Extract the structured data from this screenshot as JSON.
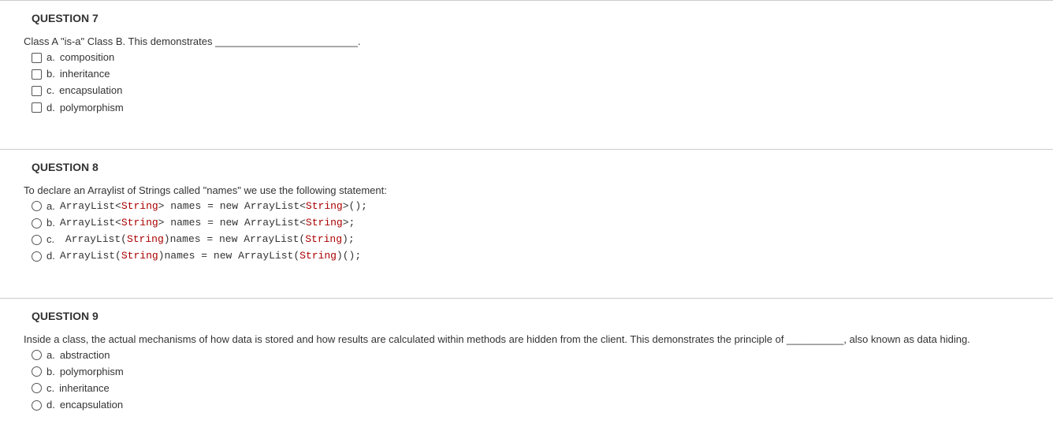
{
  "questions": [
    {
      "title": "QUESTION 7",
      "prompt": "Class A \"is-a\" Class B.  This demonstrates _________________________.",
      "input_type": "checkbox",
      "options": [
        {
          "letter": "a.",
          "text": "composition"
        },
        {
          "letter": "b.",
          "text": "inheritance"
        },
        {
          "letter": "c.",
          "text": "encapsulation"
        },
        {
          "letter": "d.",
          "text": "polymorphism"
        }
      ]
    },
    {
      "title": "QUESTION 8",
      "prompt": "To declare an Arraylist of Strings called \"names\" we  use the following statement:",
      "input_type": "radio",
      "code_options": [
        {
          "letter": "a.",
          "segments": [
            {
              "t": "ArrayList<"
            },
            {
              "t": "String",
              "kw": true
            },
            {
              "t": "> names = "
            },
            {
              "t": "new "
            },
            {
              "t": "ArrayList<"
            },
            {
              "t": "String",
              "kw": true
            },
            {
              "t": ">();"
            }
          ]
        },
        {
          "letter": "b.",
          "segments": [
            {
              "t": "ArrayList<"
            },
            {
              "t": "String",
              "kw": true
            },
            {
              "t": "> names = "
            },
            {
              "t": "new "
            },
            {
              "t": "ArrayList<"
            },
            {
              "t": "String",
              "kw": true
            },
            {
              "t": ">;"
            }
          ]
        },
        {
          "letter": "c.",
          "segments": [
            {
              "t": " ArrayList("
            },
            {
              "t": "String",
              "kw": true
            },
            {
              "t": ")names = "
            },
            {
              "t": "new "
            },
            {
              "t": "ArrayList("
            },
            {
              "t": "String",
              "kw": true
            },
            {
              "t": ");"
            }
          ]
        },
        {
          "letter": "d.",
          "segments": [
            {
              "t": "ArrayList("
            },
            {
              "t": "String",
              "kw": true
            },
            {
              "t": ")names = "
            },
            {
              "t": "new "
            },
            {
              "t": "ArrayList("
            },
            {
              "t": "String",
              "kw": true
            },
            {
              "t": ")();"
            }
          ]
        }
      ]
    },
    {
      "title": "QUESTION 9",
      "prompt": "Inside a class, the actual mechanisms of how data is stored and how results are calculated within methods are hidden from the client.  This demonstrates the principle of __________, also known as data hiding.",
      "input_type": "radio",
      "options": [
        {
          "letter": "a.",
          "text": "abstraction"
        },
        {
          "letter": "b.",
          "text": "polymorphism"
        },
        {
          "letter": "c.",
          "text": "inheritance"
        },
        {
          "letter": "d.",
          "text": "encapsulation"
        }
      ]
    }
  ]
}
